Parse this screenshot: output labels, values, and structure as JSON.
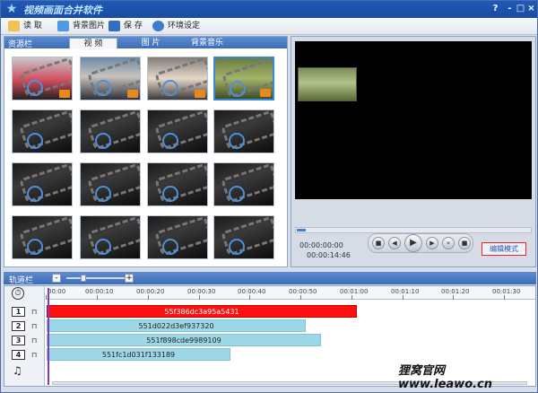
{
  "app": {
    "title": "视频画面合并软件"
  },
  "window_controls": {
    "help": "?",
    "minimize": "-",
    "maximize": "□",
    "close": "×"
  },
  "toolbar": {
    "read_label": "读 取",
    "bg_image_label": "背景图片",
    "save_label": "保 存",
    "settings_label": "环境设定"
  },
  "resource_panel": {
    "label": "资源栏",
    "tabs": [
      "视 频",
      "图 片",
      "背景音乐"
    ],
    "active_tab": 0
  },
  "preview": {
    "current_time": "00:00:00:00",
    "total_time": "00:00:14:46",
    "edit_mode_label": "编辑模式"
  },
  "timeline": {
    "label": "轨道栏",
    "zoom_minus": "-",
    "zoom_plus": "+",
    "ruler_ticks": [
      "00:00",
      "00:00:10",
      "00:00:20",
      "00:00:30",
      "00:00:40",
      "00:00:50",
      "00:01:00",
      "00:01:10",
      "00:01:20",
      "00:01:30"
    ],
    "tracks": [
      {
        "num": "1",
        "clip": "55f386dc3a95a5431"
      },
      {
        "num": "2",
        "clip": "551d022d3ef937320"
      },
      {
        "num": "3",
        "clip": "551f898cde9989109"
      },
      {
        "num": "4",
        "clip": "551fc1d031f133189"
      }
    ]
  },
  "watermark": "狸窝官网 www.leawo.cn"
}
